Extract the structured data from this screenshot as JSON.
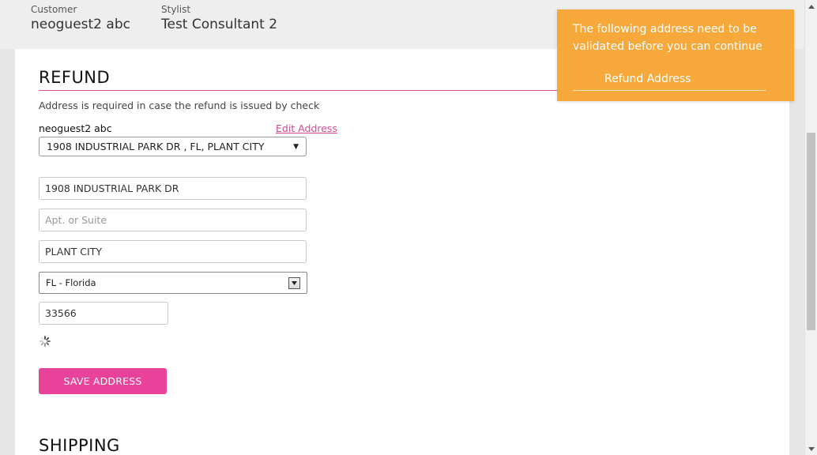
{
  "header": {
    "customer_label": "Customer",
    "customer_value": "neoguest2 abc",
    "stylist_label": "Stylist",
    "stylist_value": "Test Consultant 2"
  },
  "refund": {
    "title": "REFUND",
    "note": "Address is required in case the refund is issued by check",
    "customer_name": "neoguest2 abc",
    "edit_link": "Edit Address",
    "address_select": "1908 INDUSTRIAL PARK DR , FL, PLANT CITY",
    "street": "1908 INDUSTRIAL PARK DR",
    "apt_placeholder": "Apt. or Suite",
    "city": "PLANT CITY",
    "state": "FL - Florida",
    "zip": "33566",
    "save_button": "SAVE ADDRESS"
  },
  "shipping": {
    "title": "SHIPPING"
  },
  "toast": {
    "message": "The following address need to be validated before you can continue",
    "item": "Refund Address",
    "color": "#f6a93a"
  },
  "colors": {
    "accent": "#e8429b",
    "link": "#d14a92"
  }
}
